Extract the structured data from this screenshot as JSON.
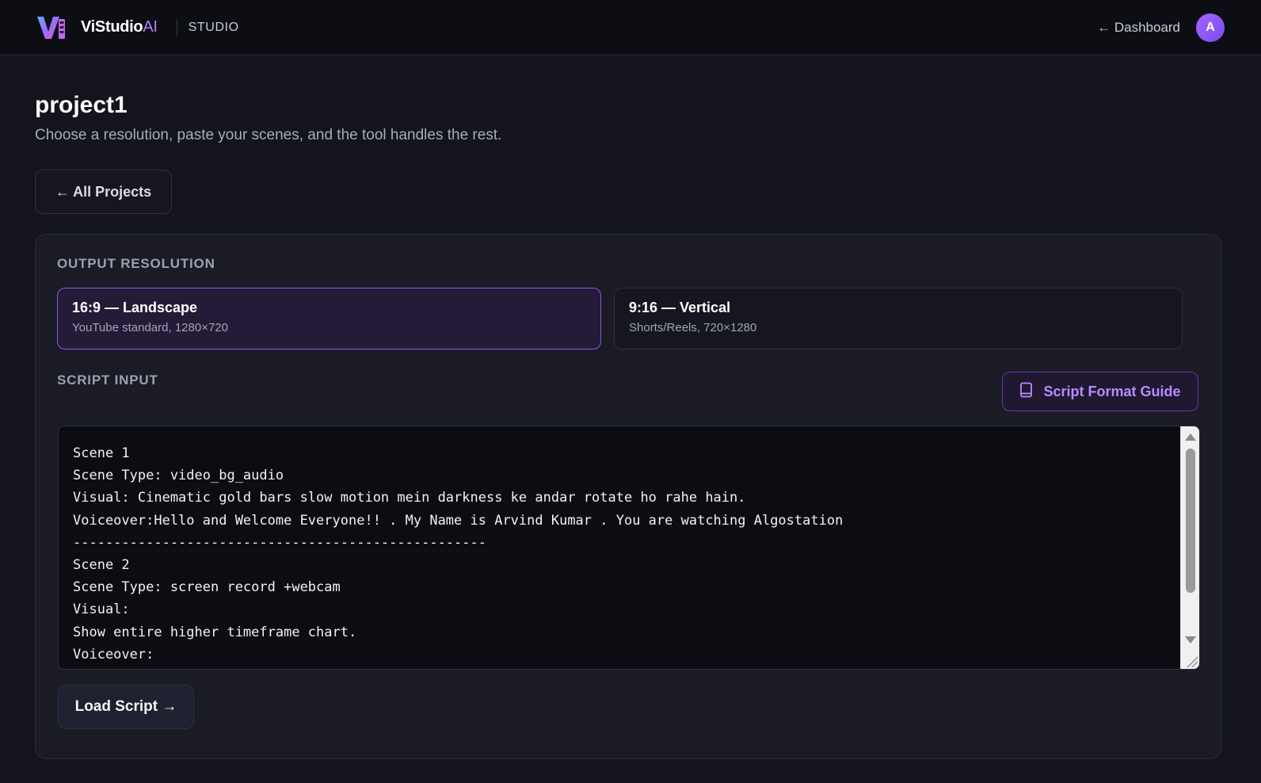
{
  "header": {
    "brand_main": "ViStudio",
    "brand_ai": "AI",
    "section": "STUDIO",
    "dashboard_link": "← Dashboard",
    "avatar_initial": "A"
  },
  "page": {
    "title": "project1",
    "subtitle": "Choose a resolution, paste your scenes, and the tool handles the rest.",
    "back_button": "← All Projects"
  },
  "output_resolution": {
    "label": "OUTPUT RESOLUTION",
    "options": [
      {
        "title": "16:9 — Landscape",
        "subtitle": "YouTube standard, 1280×720",
        "selected": true
      },
      {
        "title": "9:16 — Vertical",
        "subtitle": "Shorts/Reels, 720×1280",
        "selected": false
      }
    ]
  },
  "script_input": {
    "label": "SCRIPT INPUT",
    "guide_button": "Script Format Guide",
    "value": "Scene 1\nScene Type: video_bg_audio\nVisual: Cinematic gold bars slow motion mein darkness ke andar rotate ho rahe hain.\nVoiceover:Hello and Welcome Everyone!! . My Name is Arvind Kumar . You are watching Algostation\n---------------------------------------------------\nScene 2\nScene Type: screen record +webcam\nVisual:\nShow entire higher timeframe chart.\nVoiceover:",
    "load_button": "Load Script →"
  },
  "colors": {
    "accent": "#8a55e8",
    "accent_text": "#b98bff",
    "background": "#13141c"
  }
}
